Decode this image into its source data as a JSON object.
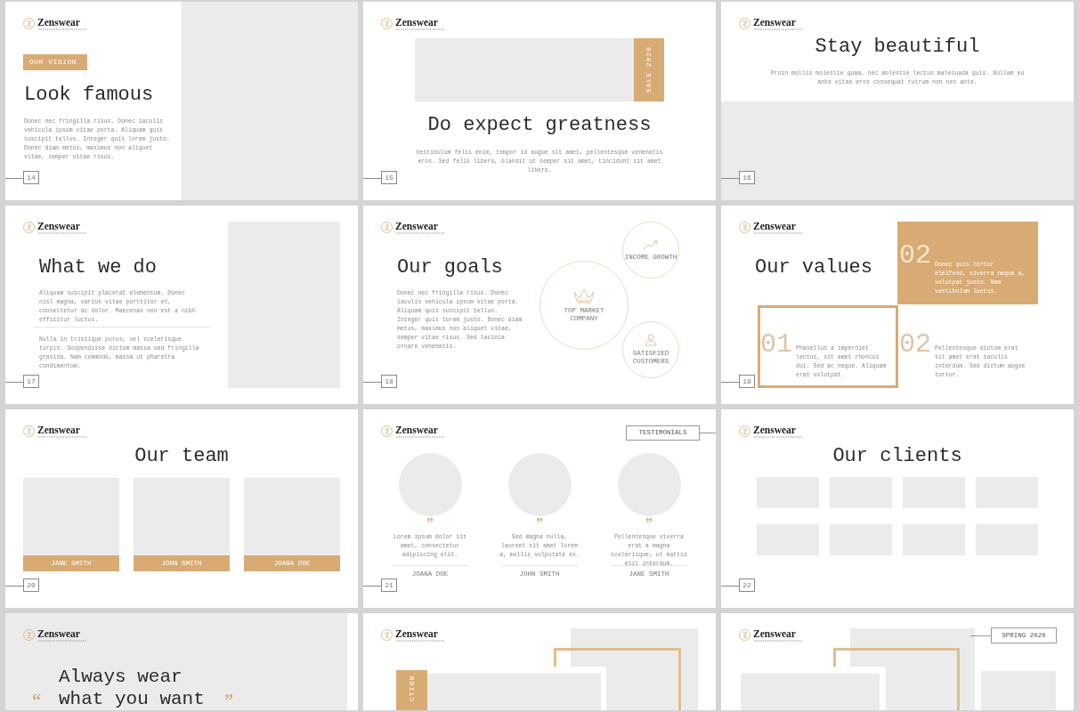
{
  "slides": [
    {
      "kind": "vision",
      "logo": "Zenswear",
      "tag": "OUR VISION",
      "title": "Look famous",
      "body": "Donec nec fringilla risus. Donec iaculis vehicula ipsum vitae porta. Aliquam quis suscipit tellus. Integer quis lorem justo. Donec diam metus, maximus non aliquet vitae, semper vitae risus.",
      "page": "14"
    },
    {
      "kind": "sale",
      "logo": "Zenswear",
      "tag": "SALE 2020",
      "title": "Do expect greatness",
      "body": "Vestibulum felis enim, tempor id augue sit amet, pellentesque venenatis eros. Sed felis libero, blandit ut semper sit amet, tincidunt sit amet libero.",
      "page": "15"
    },
    {
      "kind": "centered",
      "logo": "Zenswear",
      "title": "Stay beautiful",
      "body": "Proin mollis molestie quam, nec molestie lectus malesuada quis. Nullam eu ante vitae eros consequat rutrum non nec ante.",
      "page": "16"
    },
    {
      "kind": "what",
      "logo": "Zenswear",
      "title": "What we do",
      "paragraphs": [
        "Aliquam suscipit placerat elementum. Donec nisl magna, varius vitae porttitor et, consectetur ac dolor. Maecenas non est a nibh efficitur luctus.",
        "Nulla in tristique purus, vel scelerisque turpis. Suspendisse dictum massa sed fringilla gravida. Nam commodo, massa ut pharetra condimentum."
      ],
      "page": "17"
    },
    {
      "kind": "goals",
      "logo": "Zenswear",
      "title": "Our goals",
      "body": "Donec nec fringilla risus. Donec iaculis vehicula ipsum vitae porta. Aliquam quis suscipit tellus. Integer quis lorem justo. Donec diam metus, maximus non aliquet vitae, semper vitae risus. Sed lacinia ornare venenatis.",
      "goals": [
        {
          "label": "TOP MARKET COMPANY"
        },
        {
          "label": "INCOME GROWTH"
        },
        {
          "label": "SATISFIED CUSTOMERS"
        }
      ],
      "page": "18"
    },
    {
      "kind": "values",
      "logo": "Zenswear",
      "title": "Our values",
      "values": [
        {
          "kind": "filled",
          "number": "02",
          "text": "Donec quis tortor eleifend, viverra neque a, volutpat justo. Nam vestibulum luctus."
        },
        {
          "kind": "outlined",
          "number": "01",
          "text": "Phasellus a imperdiet lectus, sit amet rhoncus dui. Sed ac neque. Aliquam erat volutpat."
        },
        {
          "kind": "plain",
          "number": "02",
          "text": "Pellentesque dictum erat sit amet erat iaculis interdum. Sed dictum augue tortor."
        }
      ],
      "page": "19"
    },
    {
      "kind": "team",
      "logo": "Zenswear",
      "title": "Our team",
      "members": [
        {
          "name": "JANE SMITH"
        },
        {
          "name": "JOHN SMITH"
        },
        {
          "name": "JOANA DOE"
        }
      ],
      "page": "20"
    },
    {
      "kind": "testimonials",
      "logo": "Zenswear",
      "tag": "TESTIMONIALS",
      "quotes": [
        {
          "mark": "”",
          "text": "Lorem ipsum dolor sit amet, consectetur adipiscing elit.",
          "name": "JOANA DOE"
        },
        {
          "mark": "”",
          "text": "Sed magna nulla, laoreet sit amet lorem a, mollis vulputate ex.",
          "name": "JOHN SMITH"
        },
        {
          "mark": "”",
          "text": "Pellentesque viverra erat a magna scelerisque, ut mattis elit interdum.",
          "name": "JANE SMITH"
        }
      ],
      "page": "21"
    },
    {
      "kind": "clients",
      "logo": "Zenswear",
      "title": "Our clients",
      "page": "22"
    },
    {
      "kind": "quote",
      "logo": "Zenswear",
      "open": "“",
      "close": "”",
      "lines": [
        "Always wear",
        "what you want"
      ]
    },
    {
      "kind": "collection",
      "logo": "Zenswear",
      "tag": "CTION"
    },
    {
      "kind": "spring",
      "logo": "Zenswear",
      "tag": "SPRING 2020"
    }
  ]
}
